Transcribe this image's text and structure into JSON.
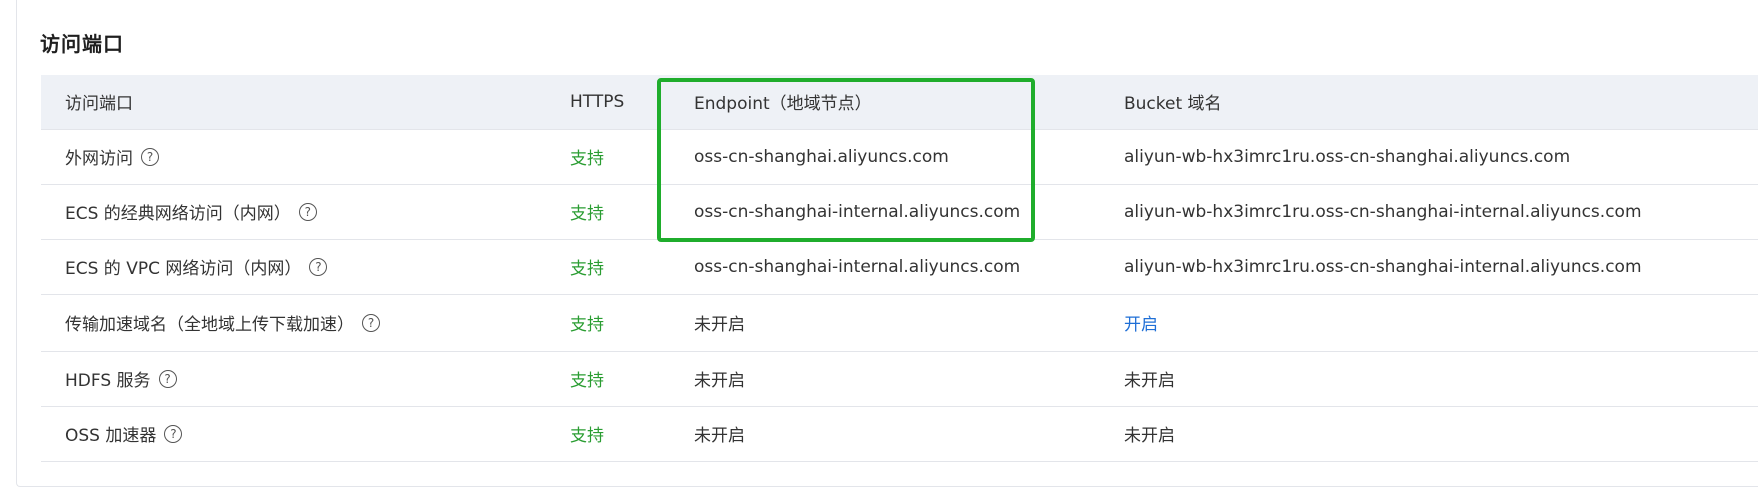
{
  "section": {
    "title": "访问端口"
  },
  "table": {
    "headers": [
      "访问端口",
      "HTTPS",
      "Endpoint（地域节点）",
      "Bucket 域名"
    ],
    "rows": [
      {
        "name": "外网访问",
        "https": "支持",
        "endpoint": "oss-cn-shanghai.aliyuncs.com",
        "bucket_domain": "aliyun-wb-hx3imrc1ru.oss-cn-shanghai.aliyuncs.com"
      },
      {
        "name": "ECS 的经典网络访问（内网）",
        "https": "支持",
        "endpoint": "oss-cn-shanghai-internal.aliyuncs.com",
        "bucket_domain": "aliyun-wb-hx3imrc1ru.oss-cn-shanghai-internal.aliyuncs.com"
      },
      {
        "name": "ECS 的 VPC 网络访问（内网）",
        "https": "支持",
        "endpoint": "oss-cn-shanghai-internal.aliyuncs.com",
        "bucket_domain": "aliyun-wb-hx3imrc1ru.oss-cn-shanghai-internal.aliyuncs.com"
      },
      {
        "name": "传输加速域名（全地域上传下载加速）",
        "https": "支持",
        "endpoint": "未开启",
        "bucket_domain": "开启"
      },
      {
        "name": "HDFS 服务",
        "https": "支持",
        "endpoint": "未开启",
        "bucket_domain": "未开启"
      },
      {
        "name": "OSS 加速器",
        "https": "支持",
        "endpoint": "未开启",
        "bucket_domain": "未开启"
      }
    ]
  },
  "icons": {
    "help": "question-circle-icon",
    "help_glyph": "?"
  },
  "colors": {
    "support_text": "#2a9d32",
    "link": "#1f6fd6",
    "highlight_box": "#1fad2c",
    "header_bg": "#eef1f6"
  }
}
